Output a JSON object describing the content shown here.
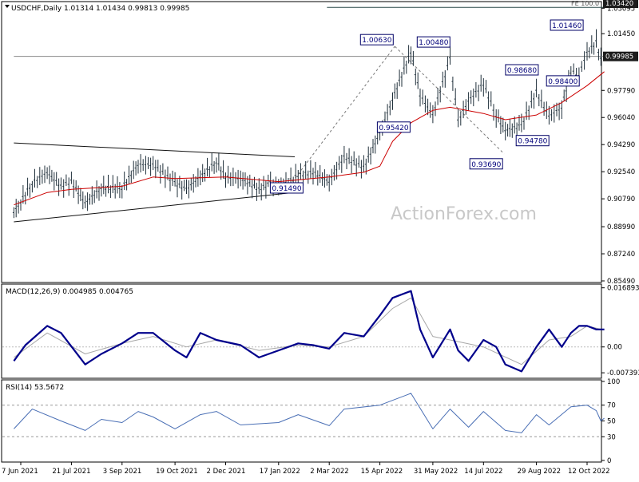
{
  "chart_data": {
    "type": "line",
    "title": "USDCHF,Daily  1.01314 1.01434 0.99813 0.99985",
    "watermark": "ActionForex.com",
    "colors": {
      "bars": "#1f2f3a",
      "ma": "#cc0000",
      "macd": "#00008b",
      "signal": "#a8a8a8",
      "rsi": "#4a6fb5",
      "grid_dashed": "#777777",
      "box_border": "#000066",
      "box_text": "#00007a",
      "price_tag_bg": "#1c1c1c"
    },
    "x_axis": {
      "labels": [
        "7 Jun 2021",
        "21 Jul 2021",
        "3 Sep 2021",
        "19 Oct 2021",
        "2 Dec 2021",
        "17 Jan 2022",
        "2 Mar 2022",
        "15 Apr 2022",
        "31 May 2022",
        "14 Jul 2022",
        "29 Aug 2022",
        "12 Oct 2022"
      ]
    },
    "price_panel": {
      "ylim": [
        0.8549,
        1.0342
      ],
      "ticks": [
        1.0342,
        1.03095,
        1.0145,
        0.9995,
        0.9779,
        0.9604,
        0.9429,
        0.9254,
        0.9079,
        0.8899,
        0.8724,
        0.8549
      ],
      "tick_labels": [
        "1.03420",
        "1.03095",
        "1.01450",
        "0.99985",
        "0.97790",
        "0.96040",
        "0.94290",
        "0.92540",
        "0.90790",
        "0.88990",
        "0.87240",
        "0.85490"
      ],
      "current_price": 0.99985,
      "current_price_label": "0.99985",
      "fe_label": "FE 100.0",
      "fe_level": 1.0315,
      "fe_tag": "1.03420",
      "annotations": [
        {
          "label": "0.91490",
          "value": 0.9149,
          "date": "24 Jan 2022"
        },
        {
          "label": "1.00630",
          "value": 1.0063,
          "date": "28 Apr 2022"
        },
        {
          "label": "1.00480",
          "value": 1.0048,
          "date": "16 May 2022"
        },
        {
          "label": "0.95420",
          "value": 0.9542,
          "date": "27 Apr 2022"
        },
        {
          "label": "0.93690",
          "value": 0.9369,
          "date": "1 Aug 2022"
        },
        {
          "label": "0.94780",
          "value": 0.9478,
          "date": "10 Aug 2022"
        },
        {
          "label": "0.98680",
          "value": 0.9868,
          "date": "1 Sep 2022"
        },
        {
          "label": "0.98400",
          "value": 0.984,
          "date": "21 Sep 2022"
        },
        {
          "label": "1.01460",
          "value": 1.0146,
          "date": "10 Oct 2022"
        }
      ],
      "close_series": [
        {
          "x": "1 Jun 2021",
          "y": 0.899
        },
        {
          "x": "7 Jun 2021",
          "y": 0.906
        },
        {
          "x": "17 Jun 2021",
          "y": 0.918
        },
        {
          "x": "30 Jun 2021",
          "y": 0.925
        },
        {
          "x": "12 Jul 2021",
          "y": 0.916
        },
        {
          "x": "21 Jul 2021",
          "y": 0.919
        },
        {
          "x": "2 Aug 2021",
          "y": 0.905
        },
        {
          "x": "16 Aug 2021",
          "y": 0.915
        },
        {
          "x": "3 Sep 2021",
          "y": 0.915
        },
        {
          "x": "17 Sep 2021",
          "y": 0.93
        },
        {
          "x": "30 Sep 2021",
          "y": 0.93
        },
        {
          "x": "19 Oct 2021",
          "y": 0.918
        },
        {
          "x": "29 Oct 2021",
          "y": 0.914
        },
        {
          "x": "10 Nov 2021",
          "y": 0.922
        },
        {
          "x": "24 Nov 2021",
          "y": 0.932
        },
        {
          "x": "2 Dec 2021",
          "y": 0.922
        },
        {
          "x": "15 Dec 2021",
          "y": 0.921
        },
        {
          "x": "31 Dec 2021",
          "y": 0.914
        },
        {
          "x": "10 Jan 2022",
          "y": 0.918
        },
        {
          "x": "17 Jan 2022",
          "y": 0.915
        },
        {
          "x": "3 Feb 2022",
          "y": 0.923
        },
        {
          "x": "16 Feb 2022",
          "y": 0.925
        },
        {
          "x": "2 Mar 2022",
          "y": 0.919
        },
        {
          "x": "15 Mar 2022",
          "y": 0.935
        },
        {
          "x": "1 Apr 2022",
          "y": 0.928
        },
        {
          "x": "15 Apr 2022",
          "y": 0.95
        },
        {
          "x": "26 Apr 2022",
          "y": 0.972
        },
        {
          "x": "12 May 2022",
          "y": 1.003
        },
        {
          "x": "20 May 2022",
          "y": 0.975
        },
        {
          "x": "31 May 2022",
          "y": 0.962
        },
        {
          "x": "15 Jun 2022",
          "y": 0.998
        },
        {
          "x": "22 Jun 2022",
          "y": 0.958
        },
        {
          "x": "1 Jul 2022",
          "y": 0.971
        },
        {
          "x": "14 Jul 2022",
          "y": 0.982
        },
        {
          "x": "25 Jul 2022",
          "y": 0.962
        },
        {
          "x": "2 Aug 2022",
          "y": 0.952
        },
        {
          "x": "16 Aug 2022",
          "y": 0.955
        },
        {
          "x": "29 Aug 2022",
          "y": 0.977
        },
        {
          "x": "9 Sep 2022",
          "y": 0.961
        },
        {
          "x": "20 Sep 2022",
          "y": 0.967
        },
        {
          "x": "28 Sep 2022",
          "y": 0.99
        },
        {
          "x": "5 Oct 2022",
          "y": 0.988
        },
        {
          "x": "12 Oct 2022",
          "y": 1.002
        },
        {
          "x": "20 Oct 2022",
          "y": 1.009
        },
        {
          "x": "24 Oct 2022",
          "y": 0.998
        },
        {
          "x": "27 Oct 2022",
          "y": 1.008
        }
      ],
      "ma_series": [
        {
          "x": "1 Jun 2021",
          "y": 0.904
        },
        {
          "x": "30 Jun 2021",
          "y": 0.912
        },
        {
          "x": "21 Jul 2021",
          "y": 0.914
        },
        {
          "x": "3 Sep 2021",
          "y": 0.916
        },
        {
          "x": "30 Sep 2021",
          "y": 0.922
        },
        {
          "x": "19 Oct 2021",
          "y": 0.921
        },
        {
          "x": "2 Dec 2021",
          "y": 0.922
        },
        {
          "x": "17 Jan 2022",
          "y": 0.919
        },
        {
          "x": "2 Mar 2022",
          "y": 0.922
        },
        {
          "x": "1 Apr 2022",
          "y": 0.925
        },
        {
          "x": "15 Apr 2022",
          "y": 0.929
        },
        {
          "x": "26 Apr 2022",
          "y": 0.945
        },
        {
          "x": "12 May 2022",
          "y": 0.957
        },
        {
          "x": "31 May 2022",
          "y": 0.965
        },
        {
          "x": "15 Jun 2022",
          "y": 0.967
        },
        {
          "x": "14 Jul 2022",
          "y": 0.963
        },
        {
          "x": "2 Aug 2022",
          "y": 0.959
        },
        {
          "x": "29 Aug 2022",
          "y": 0.962
        },
        {
          "x": "20 Sep 2022",
          "y": 0.97
        },
        {
          "x": "12 Oct 2022",
          "y": 0.981
        },
        {
          "x": "27 Oct 2022",
          "y": 0.99
        }
      ],
      "trend_lines": [
        {
          "name": "upper",
          "from": {
            "x": "1 Jun 2021",
            "y": 0.944
          },
          "to": {
            "x": "31 Jan 2022",
            "y": 0.935
          }
        },
        {
          "name": "lower",
          "from": {
            "x": "1 Jun 2021",
            "y": 0.893
          },
          "to": {
            "x": "31 Jan 2022",
            "y": 0.912
          }
        },
        {
          "name": "fe-line",
          "from": {
            "x": "28 Feb 2022",
            "y": 1.0315
          },
          "to": {
            "x": "27 Oct 2022",
            "y": 1.0315
          }
        },
        {
          "name": "current-line",
          "from": {
            "x": "1 Jun 2021",
            "y": 0.99985
          },
          "to": {
            "x": "27 Oct 2022",
            "y": 0.99985
          }
        }
      ],
      "dashed_lines": [
        {
          "from": {
            "x": "24 Jan 2022",
            "y": 0.914
          },
          "to": {
            "x": "28 Apr 2022",
            "y": 1.0063
          }
        },
        {
          "from": {
            "x": "28 Apr 2022",
            "y": 1.0063
          },
          "to": {
            "x": "1 Aug 2022",
            "y": 0.9369
          }
        }
      ]
    },
    "macd_panel": {
      "title": "MACD(12,26,9) 0.004985 0.004765",
      "ylim": [
        -0.0085,
        0.0175
      ],
      "ticks": [
        0.016893,
        0.0,
        -0.007393
      ],
      "tick_labels": [
        "0.016893",
        "0.00",
        "-0.007393"
      ],
      "macd_series": [
        {
          "x": "1 Jun 2021",
          "y": -0.004
        },
        {
          "x": "11 Jun 2021",
          "y": 0.0005
        },
        {
          "x": "30 Jun 2021",
          "y": 0.006
        },
        {
          "x": "12 Jul 2021",
          "y": 0.004
        },
        {
          "x": "2 Aug 2021",
          "y": -0.005
        },
        {
          "x": "16 Aug 2021",
          "y": -0.002
        },
        {
          "x": "3 Sep 2021",
          "y": 0.001
        },
        {
          "x": "17 Sep 2021",
          "y": 0.004
        },
        {
          "x": "30 Sep 2021",
          "y": 0.004
        },
        {
          "x": "19 Oct 2021",
          "y": -0.001
        },
        {
          "x": "29 Oct 2021",
          "y": -0.003
        },
        {
          "x": "10 Nov 2021",
          "y": 0.004
        },
        {
          "x": "24 Nov 2021",
          "y": 0.002
        },
        {
          "x": "15 Dec 2021",
          "y": 0.0005
        },
        {
          "x": "31 Dec 2021",
          "y": -0.003
        },
        {
          "x": "17 Jan 2022",
          "y": -0.001
        },
        {
          "x": "3 Feb 2022",
          "y": 0.001
        },
        {
          "x": "16 Feb 2022",
          "y": 0.0005
        },
        {
          "x": "2 Mar 2022",
          "y": -0.0005
        },
        {
          "x": "15 Mar 2022",
          "y": 0.004
        },
        {
          "x": "1 Apr 2022",
          "y": 0.003
        },
        {
          "x": "15 Apr 2022",
          "y": 0.009
        },
        {
          "x": "26 Apr 2022",
          "y": 0.014
        },
        {
          "x": "12 May 2022",
          "y": 0.016
        },
        {
          "x": "20 May 2022",
          "y": 0.005
        },
        {
          "x": "31 May 2022",
          "y": -0.003
        },
        {
          "x": "15 Jun 2022",
          "y": 0.005
        },
        {
          "x": "22 Jun 2022",
          "y": -0.001
        },
        {
          "x": "1 Jul 2022",
          "y": -0.004
        },
        {
          "x": "14 Jul 2022",
          "y": 0.002
        },
        {
          "x": "25 Jul 2022",
          "y": 0.0
        },
        {
          "x": "2 Aug 2022",
          "y": -0.005
        },
        {
          "x": "16 Aug 2022",
          "y": -0.007
        },
        {
          "x": "29 Aug 2022",
          "y": 0.0
        },
        {
          "x": "9 Sep 2022",
          "y": 0.005
        },
        {
          "x": "20 Sep 2022",
          "y": 0.0
        },
        {
          "x": "28 Sep 2022",
          "y": 0.004
        },
        {
          "x": "5 Oct 2022",
          "y": 0.006
        },
        {
          "x": "12 Oct 2022",
          "y": 0.006
        },
        {
          "x": "20 Oct 2022",
          "y": 0.005
        },
        {
          "x": "27 Oct 2022",
          "y": 0.005
        }
      ],
      "signal_series": [
        {
          "x": "1 Jun 2021",
          "y": -0.003
        },
        {
          "x": "30 Jun 2021",
          "y": 0.004
        },
        {
          "x": "2 Aug 2021",
          "y": -0.002
        },
        {
          "x": "3 Sep 2021",
          "y": 0.001
        },
        {
          "x": "30 Sep 2021",
          "y": 0.003
        },
        {
          "x": "29 Oct 2021",
          "y": 0.0
        },
        {
          "x": "24 Nov 2021",
          "y": 0.002
        },
        {
          "x": "31 Dec 2021",
          "y": -0.001
        },
        {
          "x": "3 Feb 2022",
          "y": 0.0005
        },
        {
          "x": "2 Mar 2022",
          "y": 0.0
        },
        {
          "x": "1 Apr 2022",
          "y": 0.003
        },
        {
          "x": "26 Apr 2022",
          "y": 0.011
        },
        {
          "x": "12 May 2022",
          "y": 0.014
        },
        {
          "x": "31 May 2022",
          "y": 0.003
        },
        {
          "x": "15 Jun 2022",
          "y": 0.002
        },
        {
          "x": "14 Jul 2022",
          "y": 0.0
        },
        {
          "x": "16 Aug 2022",
          "y": -0.005
        },
        {
          "x": "9 Sep 2022",
          "y": 0.002
        },
        {
          "x": "28 Sep 2022",
          "y": 0.003
        },
        {
          "x": "12 Oct 2022",
          "y": 0.006
        },
        {
          "x": "27 Oct 2022",
          "y": 0.0048
        }
      ]
    },
    "rsi_panel": {
      "title": "RSI(14) 53.5672",
      "ylim": [
        0,
        100
      ],
      "ticks": [
        100,
        70,
        50,
        30,
        0
      ],
      "tick_labels": [
        "100",
        "70",
        "50",
        "30",
        "0"
      ],
      "levels": [
        70,
        30
      ],
      "rsi_series": [
        {
          "x": "1 Jun 2021",
          "y": 40
        },
        {
          "x": "17 Jun 2021",
          "y": 65
        },
        {
          "x": "12 Jul 2021",
          "y": 50
        },
        {
          "x": "2 Aug 2021",
          "y": 38
        },
        {
          "x": "16 Aug 2021",
          "y": 52
        },
        {
          "x": "3 Sep 2021",
          "y": 48
        },
        {
          "x": "17 Sep 2021",
          "y": 62
        },
        {
          "x": "30 Sep 2021",
          "y": 55
        },
        {
          "x": "19 Oct 2021",
          "y": 40
        },
        {
          "x": "10 Nov 2021",
          "y": 58
        },
        {
          "x": "24 Nov 2021",
          "y": 62
        },
        {
          "x": "15 Dec 2021",
          "y": 45
        },
        {
          "x": "17 Jan 2022",
          "y": 48
        },
        {
          "x": "3 Feb 2022",
          "y": 58
        },
        {
          "x": "2 Mar 2022",
          "y": 44
        },
        {
          "x": "15 Mar 2022",
          "y": 65
        },
        {
          "x": "15 Apr 2022",
          "y": 70
        },
        {
          "x": "12 May 2022",
          "y": 85
        },
        {
          "x": "31 May 2022",
          "y": 40
        },
        {
          "x": "15 Jun 2022",
          "y": 65
        },
        {
          "x": "1 Jul 2022",
          "y": 42
        },
        {
          "x": "14 Jul 2022",
          "y": 62
        },
        {
          "x": "2 Aug 2022",
          "y": 38
        },
        {
          "x": "16 Aug 2022",
          "y": 35
        },
        {
          "x": "29 Aug 2022",
          "y": 58
        },
        {
          "x": "9 Sep 2022",
          "y": 45
        },
        {
          "x": "28 Sep 2022",
          "y": 68
        },
        {
          "x": "12 Oct 2022",
          "y": 70
        },
        {
          "x": "20 Oct 2022",
          "y": 63
        },
        {
          "x": "24 Oct 2022",
          "y": 50
        },
        {
          "x": "27 Oct 2022",
          "y": 53.5672
        }
      ]
    }
  }
}
